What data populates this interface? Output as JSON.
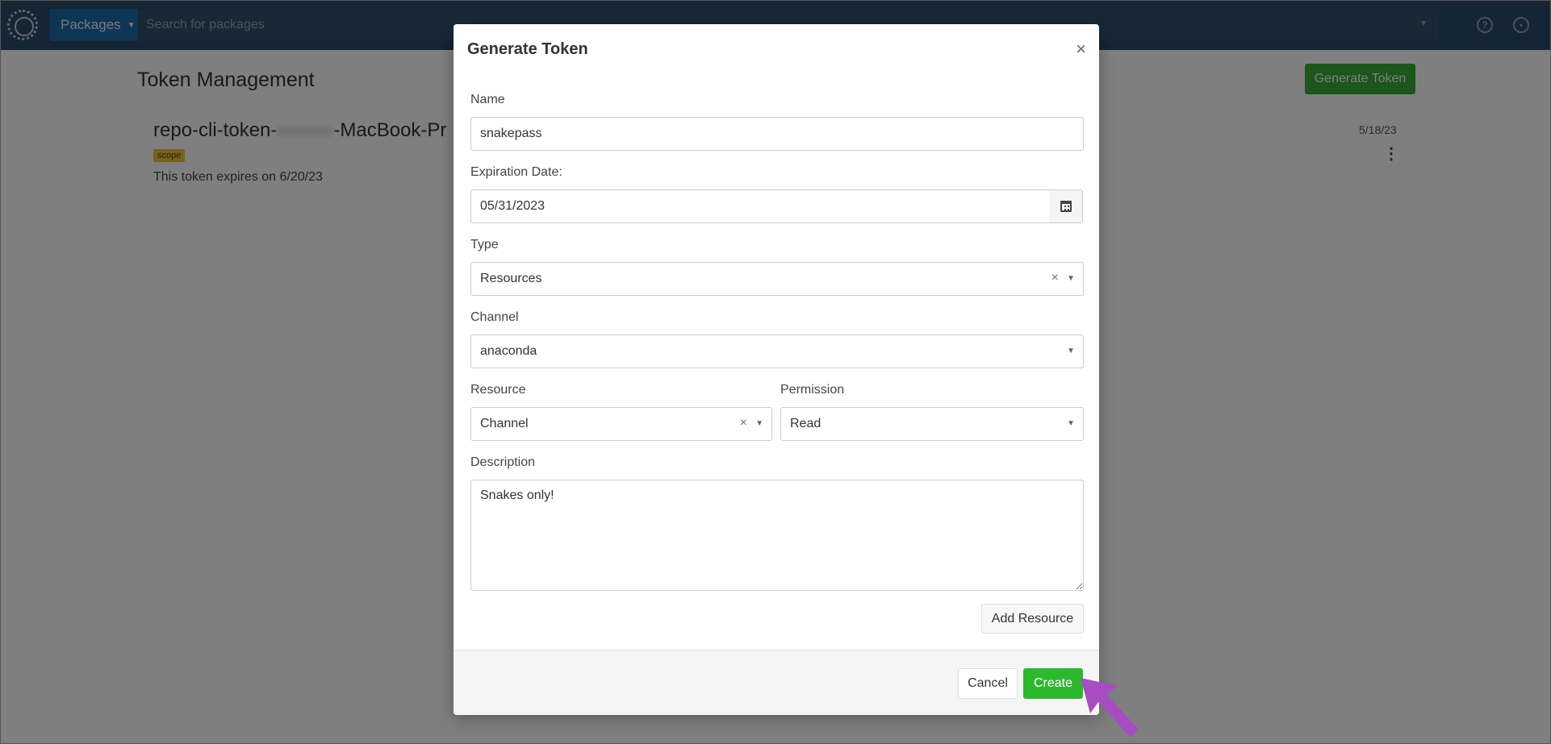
{
  "topbar": {
    "packages_label": "Packages",
    "search_placeholder": "Search for packages"
  },
  "page": {
    "title": "Token Management",
    "generate_button": "Generate Token"
  },
  "token": {
    "name_prefix": "repo-cli-token-",
    "name_suffix": "-MacBook-Pr",
    "scope_badge": "scope",
    "expires_text": "This token expires on 6/20/23",
    "date": "5/18/23"
  },
  "modal": {
    "title": "Generate Token",
    "close": "×",
    "name_label": "Name",
    "name_value": "snakepass",
    "expiration_label": "Expiration Date:",
    "expiration_value": "05/31/2023",
    "type_label": "Type",
    "type_value": "Resources",
    "channel_label": "Channel",
    "channel_value": "anaconda",
    "resource_label": "Resource",
    "resource_value": "Channel",
    "permission_label": "Permission",
    "permission_value": "Read",
    "description_label": "Description",
    "description_value": "Snakes only!",
    "add_resource_button": "Add Resource",
    "cancel_button": "Cancel",
    "create_button": "Create"
  },
  "colors": {
    "topbar": "#2d4a66",
    "primary_green": "#2eb82e",
    "annotation_arrow": "#a64dc4"
  }
}
